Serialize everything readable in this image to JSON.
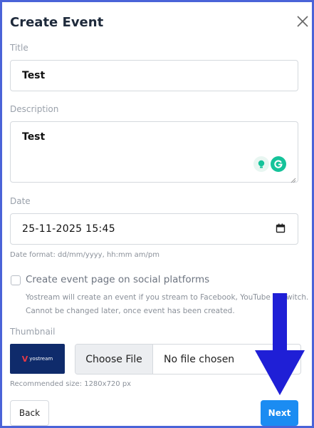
{
  "dialog": {
    "title": "Create Event"
  },
  "form": {
    "title_label": "Title",
    "title_value": "Test",
    "description_label": "Description",
    "description_value": "Test",
    "date_label": "Date",
    "date_value": "25-11-2025 15:45",
    "date_hint": "Date format: dd/mm/yyyy, hh:mm am/pm",
    "social_checkbox_label": "Create event page on social platforms",
    "social_checkbox_checked": false,
    "social_description": "Yostream will create an event if you stream to Facebook, YouTube or Twitch. Cannot be changed later, once event has been created.",
    "thumbnail_label": "Thumbnail",
    "thumbnail_logo_text": "yostream",
    "file_button": "Choose File",
    "file_status": "No file chosen",
    "thumbnail_hint": "Recommended size: 1280x720 px"
  },
  "actions": {
    "back": "Back",
    "next": "Next"
  },
  "colors": {
    "frame": "#4a63d8",
    "next_button": "#1b8cf2",
    "annotation_arrow": "#1f1fd6",
    "grammarly": "#15c39a"
  },
  "icons": [
    "close-icon",
    "calendar-icon",
    "grammarly-bulb-icon",
    "grammarly-icon",
    "resize-handle-icon",
    "annotation-arrow"
  ]
}
